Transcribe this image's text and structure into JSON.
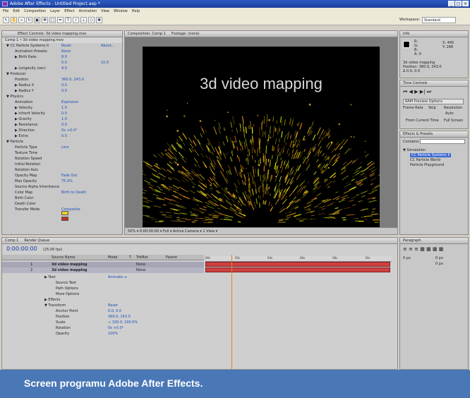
{
  "window": {
    "title": "Adobe After Effects - Untitled Project.aep *",
    "controls": [
      "_",
      "□",
      "×"
    ]
  },
  "menu": [
    "File",
    "Edit",
    "Composition",
    "Layer",
    "Effect",
    "Animation",
    "View",
    "Window",
    "Help"
  ],
  "toolbar": {
    "workspace_label": "Workspace:",
    "workspace_value": "Standard",
    "tool_icons": [
      "select-icon",
      "hand-icon",
      "zoom-icon",
      "rotate-icon",
      "camera-icon",
      "pan-icon",
      "mask-icon",
      "pen-icon",
      "text-icon",
      "brush-icon",
      "clone-icon",
      "eraser-icon",
      "puppet-icon"
    ]
  },
  "effect_controls": {
    "tab": "Effect Controls: 3d video mapping.mov",
    "subtitle": "Comp 1 • 3d video mapping.mov",
    "rows": [
      {
        "label": "▼ CC Particle Systems II",
        "value": "Reset",
        "value2": "About..."
      },
      {
        "label": "Animation Presets:",
        "value": "None"
      },
      {
        "label": "▶ Birth Rate",
        "value": "8.0"
      },
      {
        "label": "",
        "value": "0.0",
        "value2": "10.0"
      },
      {
        "label": "▶ Longevity (sec)",
        "value": "4.0"
      },
      {
        "label": "▼ Producer",
        "value": ""
      },
      {
        "label": "Position",
        "value": "360.0, 243.0"
      },
      {
        "label": "▶ Radius X",
        "value": "0.0"
      },
      {
        "label": "▶ Radius Y",
        "value": "0.0"
      },
      {
        "label": "▼ Physics",
        "value": ""
      },
      {
        "label": "Animation",
        "value": "Explosive"
      },
      {
        "label": "▶ Velocity",
        "value": "1.0"
      },
      {
        "label": "▶ Inherit Velocity",
        "value": "0.0"
      },
      {
        "label": "▶ Gravity",
        "value": "1.0"
      },
      {
        "label": "▶ Resistance",
        "value": "0.0"
      },
      {
        "label": "▶ Direction",
        "value": "0x +0.0°"
      },
      {
        "label": "▶ Extra",
        "value": "0.0"
      },
      {
        "label": "▼ Particle",
        "value": ""
      },
      {
        "label": "Particle Type",
        "value": "Line"
      },
      {
        "label": "Texture Time",
        "value": ""
      },
      {
        "label": "Rotation Speed",
        "value": ""
      },
      {
        "label": "Initial Rotation",
        "value": ""
      },
      {
        "label": "Rotation Axis",
        "value": ""
      },
      {
        "label": "Opacity Map",
        "value": "Fade Out"
      },
      {
        "label": "Max Opacity",
        "value": "75.0%"
      },
      {
        "label": "Source Alpha Inheritance",
        "value": ""
      },
      {
        "label": "Color Map",
        "value": "Birth to Death"
      },
      {
        "label": "Birth Color",
        "value": ""
      },
      {
        "label": "Death Color",
        "value": ""
      },
      {
        "label": "Transfer Mode",
        "value": "Composite"
      }
    ],
    "birth_color": "#f0d020",
    "death_color": "#c03020"
  },
  "composition": {
    "tabs": [
      "Composition: Comp 1",
      "Footage: (none)"
    ],
    "title_text": "3d video mapping",
    "statusbar": "50%  ▾  0:00:00:00  ▾  Full  ▾  Active Camera  ▾  1 View  ▾"
  },
  "info_panel": {
    "tab": "Info",
    "lines": [
      "R:",
      "G:",
      "B:",
      "A: 0",
      "X: 445",
      "Y: 266"
    ],
    "layer": "3d video mapping",
    "detail1": "Position: 360.0, 243.0",
    "detail2": "Δ 0.0, 0.0"
  },
  "time_controls": {
    "tab": "Time Controls",
    "option": "RAM Preview Options",
    "frame_rate": "Frame Rate",
    "skip": "Skip",
    "resolution": "Resolution",
    "auto": "Auto",
    "from_current": "From Current Time",
    "full_screen": "Full Screen"
  },
  "effects_presets": {
    "tab": "Effects & Presets",
    "search": "Contains:",
    "category": "▼ Simulation",
    "items": [
      "CC Particle Systems II",
      "CC Particle World",
      "Particle Playground"
    ]
  },
  "timeline": {
    "tabs": [
      "Comp 1",
      "Render Queue"
    ],
    "timecode": "0:00:00:00",
    "fps": "(25.00 fps)",
    "columns": [
      "Source Name",
      "Mode",
      "T",
      "TrkMat",
      "Parent"
    ],
    "ruler": [
      "00s",
      "02s",
      "04s",
      "06s",
      "08s",
      "10s"
    ],
    "layers": [
      {
        "num": "1",
        "name": "3d video mapping",
        "mode": "None"
      },
      {
        "num": "2",
        "name": "3d video mapping",
        "mode": "None"
      }
    ],
    "props": [
      {
        "label": "▶ Text",
        "value": "Animate: ▸"
      },
      {
        "label": "Source Text",
        "value": ""
      },
      {
        "label": "Path Options",
        "value": ""
      },
      {
        "label": "More Options",
        "value": ""
      },
      {
        "label": "▶ Effects",
        "value": ""
      },
      {
        "label": "▼ Transform",
        "value": "Reset"
      },
      {
        "label": "Anchor Point",
        "value": "0.0, 0.0"
      },
      {
        "label": "Position",
        "value": "360.0, 243.0"
      },
      {
        "label": "Scale",
        "value": "∞ 100.0, 100.0%"
      },
      {
        "label": "Rotation",
        "value": "0x +0.0°"
      },
      {
        "label": "Opacity",
        "value": "100%"
      }
    ]
  },
  "paragraph_panel": {
    "tab": "Paragraph",
    "row1": "0 px",
    "row2": "0 px",
    "row3": "0 px"
  },
  "caption": "Screen programu Adobe After Effects."
}
